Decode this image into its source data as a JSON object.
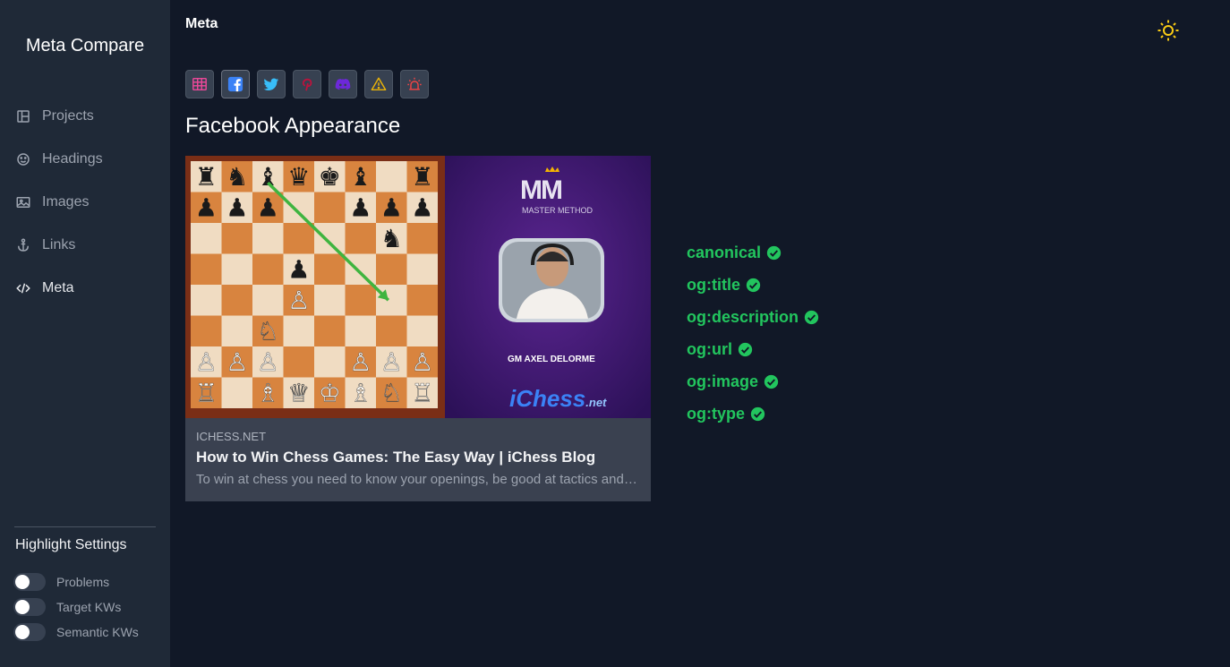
{
  "sidebar": {
    "brand": "Meta Compare",
    "items": [
      {
        "label": "Projects",
        "icon": "layout-icon"
      },
      {
        "label": "Headings",
        "icon": "smiley-icon"
      },
      {
        "label": "Images",
        "icon": "image-icon"
      },
      {
        "label": "Links",
        "icon": "anchor-icon"
      },
      {
        "label": "Meta",
        "icon": "code-icon",
        "active": true
      }
    ],
    "highlight_title": "Highlight Settings",
    "toggles": [
      {
        "label": "Problems",
        "on": false
      },
      {
        "label": "Target KWs",
        "on": false
      },
      {
        "label": "Semantic KWs",
        "on": false
      }
    ]
  },
  "header": {
    "title": "Meta",
    "theme_icon": "sun-icon"
  },
  "toolbar": {
    "buttons": [
      {
        "name": "table-icon",
        "color": "#ec4899"
      },
      {
        "name": "facebook-icon",
        "color": "#3b82f6"
      },
      {
        "name": "twitter-icon",
        "color": "#38bdf8"
      },
      {
        "name": "pinterest-icon",
        "color": "#be123c"
      },
      {
        "name": "discord-icon",
        "color": "#6d28d9"
      },
      {
        "name": "warning-icon",
        "color": "#eab308"
      },
      {
        "name": "siren-icon",
        "color": "#ef4444"
      }
    ]
  },
  "main": {
    "section_title": "Facebook Appearance",
    "card": {
      "domain": "ICHESS.NET",
      "title": "How to Win Chess Games: The Easy Way | iChess Blog",
      "description": "To win at chess you need to know your openings, be good at tactics and make sure you avoid blunders...",
      "image_texts": {
        "logo": "MM",
        "tagline": "MASTER METHOD",
        "caption": "GM AXEL DELORME",
        "brand": "iChess",
        "brand_suffix": ".net"
      }
    },
    "checks": [
      {
        "label": "canonical",
        "status": "ok"
      },
      {
        "label": "og:title",
        "status": "ok"
      },
      {
        "label": "og:description",
        "status": "ok"
      },
      {
        "label": "og:url",
        "status": "ok"
      },
      {
        "label": "og:image",
        "status": "ok"
      },
      {
        "label": "og:type",
        "status": "ok"
      }
    ]
  },
  "colors": {
    "background": "#111827",
    "sidebar": "#1f2937",
    "success": "#22c55e",
    "sun": "#facc15"
  }
}
